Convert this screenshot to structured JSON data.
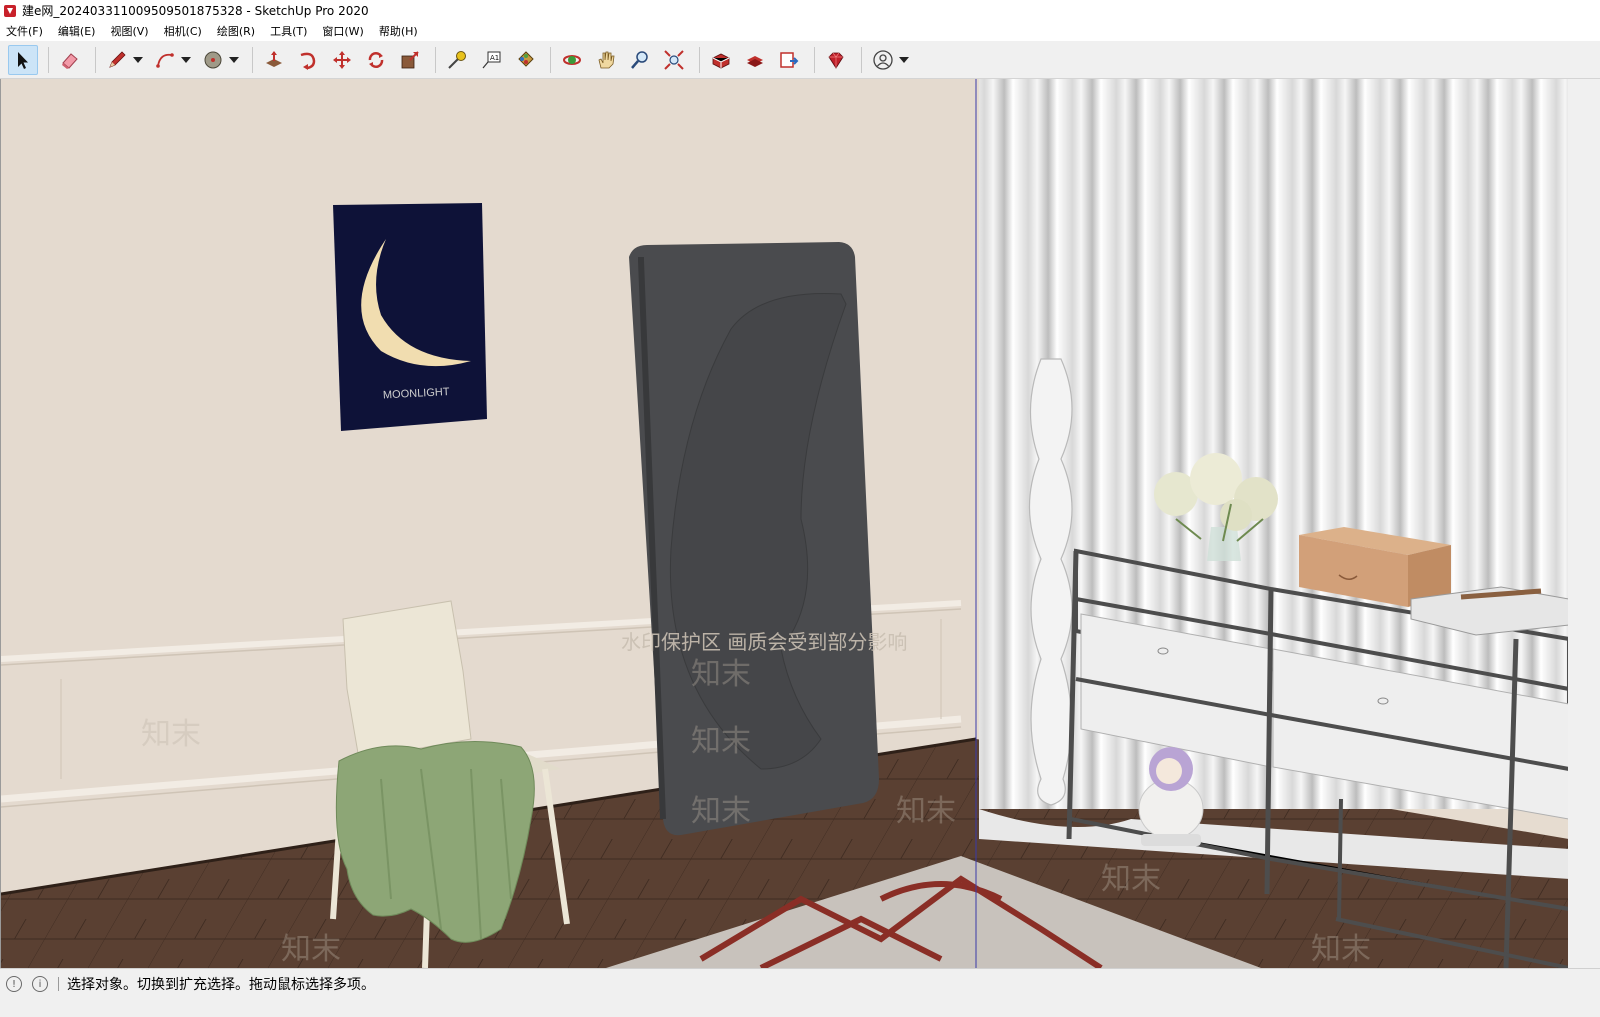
{
  "window": {
    "title": "建e网_20240331100950950187532​8 - SketchUp Pro 2020"
  },
  "menu": {
    "items": [
      {
        "label": "文件(F)"
      },
      {
        "label": "编辑(E)"
      },
      {
        "label": "视图(V)"
      },
      {
        "label": "相机(C)"
      },
      {
        "label": "绘图(R)"
      },
      {
        "label": "工具(T)"
      },
      {
        "label": "窗口(W)"
      },
      {
        "label": "帮助(H)"
      }
    ]
  },
  "toolbar": {
    "tools": [
      "select-tool",
      "eraser-tool",
      "pencil-line-tool",
      "arc-tool",
      "paint-bucket-tool",
      "push-pull-tool",
      "follow-me-tool",
      "move-tool",
      "rotate-tool",
      "scale-tool",
      "tape-measure-tool",
      "text-tool",
      "paint-tool",
      "orbit-tool",
      "pan-tool",
      "zoom-tool",
      "zoom-extents-tool",
      "warehouse-tool",
      "extension-warehouse-tool",
      "send-to-layout-tool",
      "ruby-tool",
      "account-tool"
    ]
  },
  "scene": {
    "poster_text": "MOONLIGHT",
    "watermark_banner": "水印保护区   画质会受到部分影响",
    "watermark_logo": "知末"
  },
  "status": {
    "message": "选择对象。切换到扩充选择。拖动鼠标选择多项。"
  }
}
